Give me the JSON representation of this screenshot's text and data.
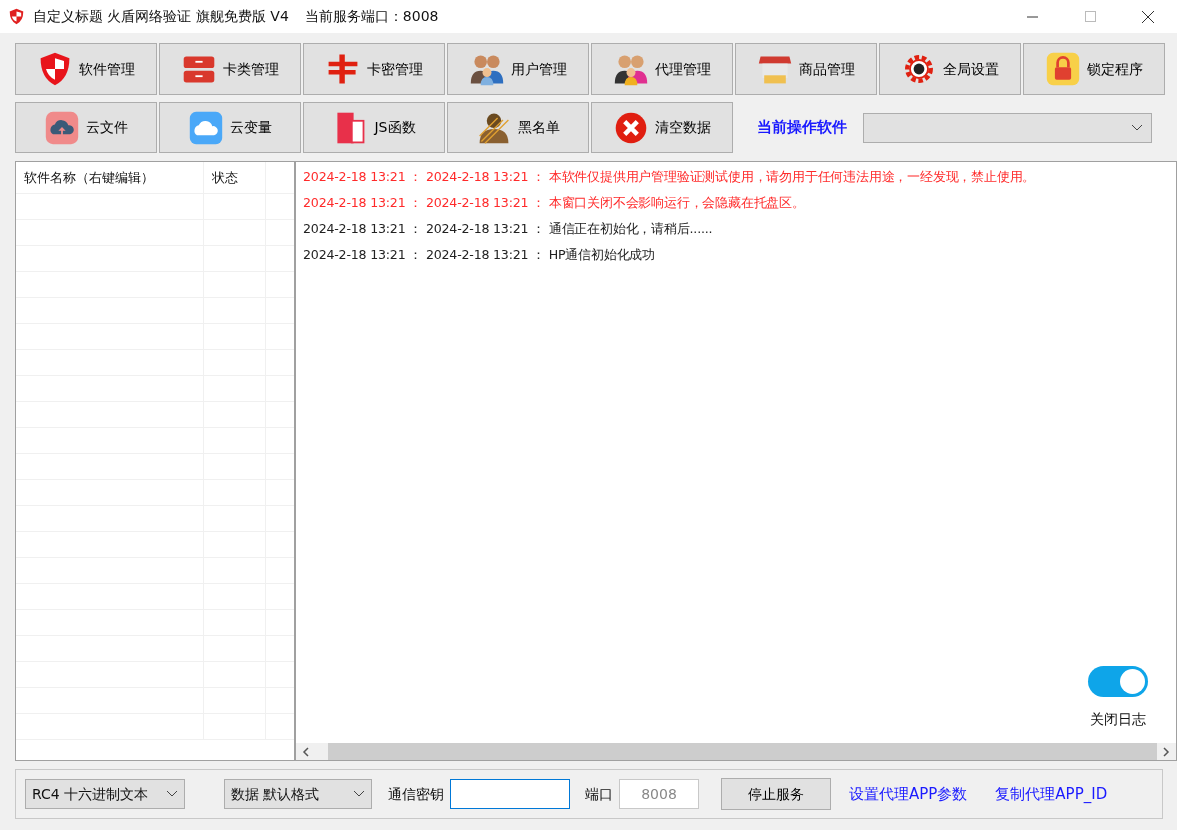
{
  "window": {
    "title": "自定义标题 火盾网络验证 旗舰免费版 V4",
    "port_label": "当前服务端口：8008"
  },
  "toolbar_row_1": [
    {
      "label": "软件管理"
    },
    {
      "label": "卡类管理"
    },
    {
      "label": "卡密管理"
    },
    {
      "label": "用户管理"
    },
    {
      "label": "代理管理"
    },
    {
      "label": "商品管理"
    },
    {
      "label": "全局设置"
    },
    {
      "label": "锁定程序"
    }
  ],
  "toolbar_row_2": [
    {
      "label": "云文件"
    },
    {
      "label": "云变量"
    },
    {
      "label": "JS函数"
    },
    {
      "label": "黑名单"
    },
    {
      "label": "清空数据"
    }
  ],
  "current_software": {
    "label": "当前操作软件"
  },
  "software_table": {
    "columns": [
      "软件名称（右键编辑）",
      "状态"
    ]
  },
  "log": [
    {
      "text": "2024-2-18 13:21 ： 2024-2-18 13:21 ： 本软件仅提供用户管理验证测试使用，请勿用于任何违法用途，一经发现，禁止使用。",
      "color": "#ff2a2a"
    },
    {
      "text": "2024-2-18 13:21 ： 2024-2-18 13:21 ： 本窗口关闭不会影响运行，会隐藏在托盘区。",
      "color": "#ff2a2a"
    },
    {
      "text": "2024-2-18 13:21 ： 2024-2-18 13:21 ： 通信正在初始化，请稍后......",
      "color": "#222222"
    },
    {
      "text": "2024-2-18 13:21 ： 2024-2-18 13:21 ： HP通信初始化成功",
      "color": "#222222"
    }
  ],
  "log_toggle": {
    "label": "关闭日志",
    "on": true
  },
  "footer": {
    "encryption": "RC4 十六进制文本",
    "data_format": "数据 默认格式",
    "key_label": "通信密钥",
    "port_label": "端口",
    "port": "8008",
    "stop_button": "停止服务",
    "links": [
      "设置代理APP参数",
      "复制代理APP_ID"
    ]
  }
}
